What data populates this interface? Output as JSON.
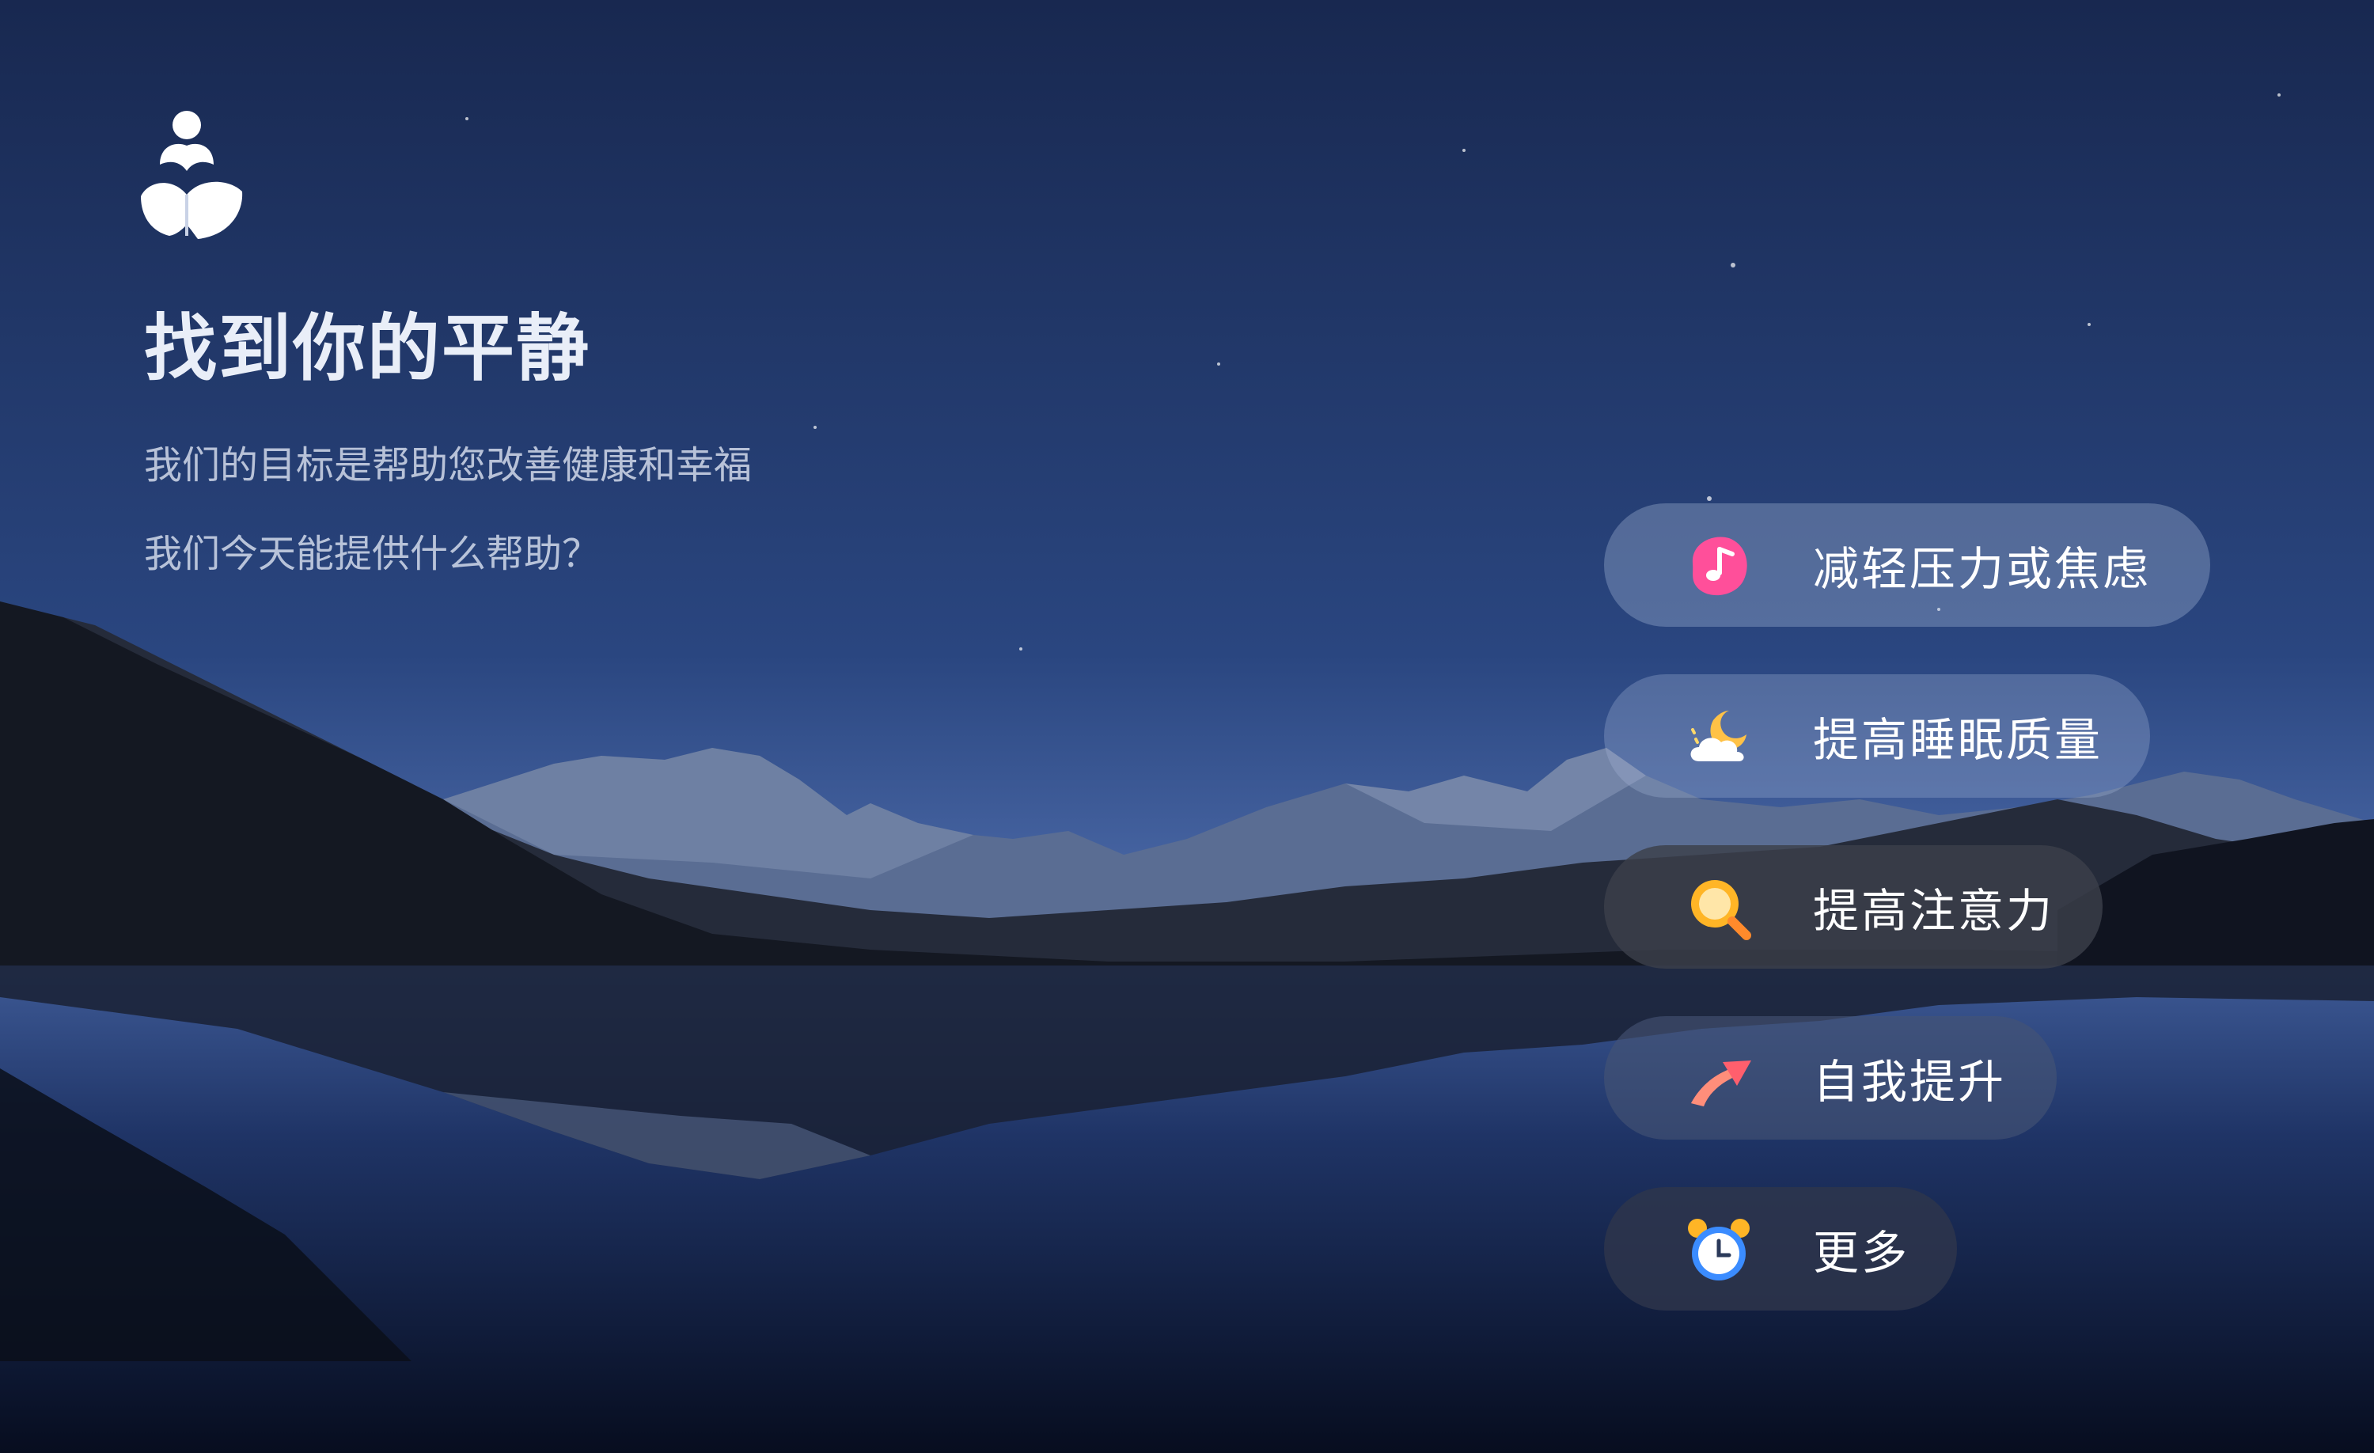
{
  "hero": {
    "title": "找到你的平静",
    "subtitle_1": "我们的目标是帮助您改善健康和幸福",
    "subtitle_2": "我们今天能提供什么帮助？"
  },
  "options": [
    {
      "label": "减轻压力或焦虑",
      "icon": "music-note-icon"
    },
    {
      "label": "提高睡眠质量",
      "icon": "cloud-moon-icon"
    },
    {
      "label": "提高注意力",
      "icon": "magnifier-icon"
    },
    {
      "label": "自我提升",
      "icon": "rising-arrow-icon"
    },
    {
      "label": "更多",
      "icon": "alarm-clock-icon"
    }
  ],
  "colors": {
    "sky_top": "#1a2a55",
    "sky_horizon": "#4a6aa8",
    "water": "#0c1630",
    "text_primary": "#e9eef8"
  }
}
